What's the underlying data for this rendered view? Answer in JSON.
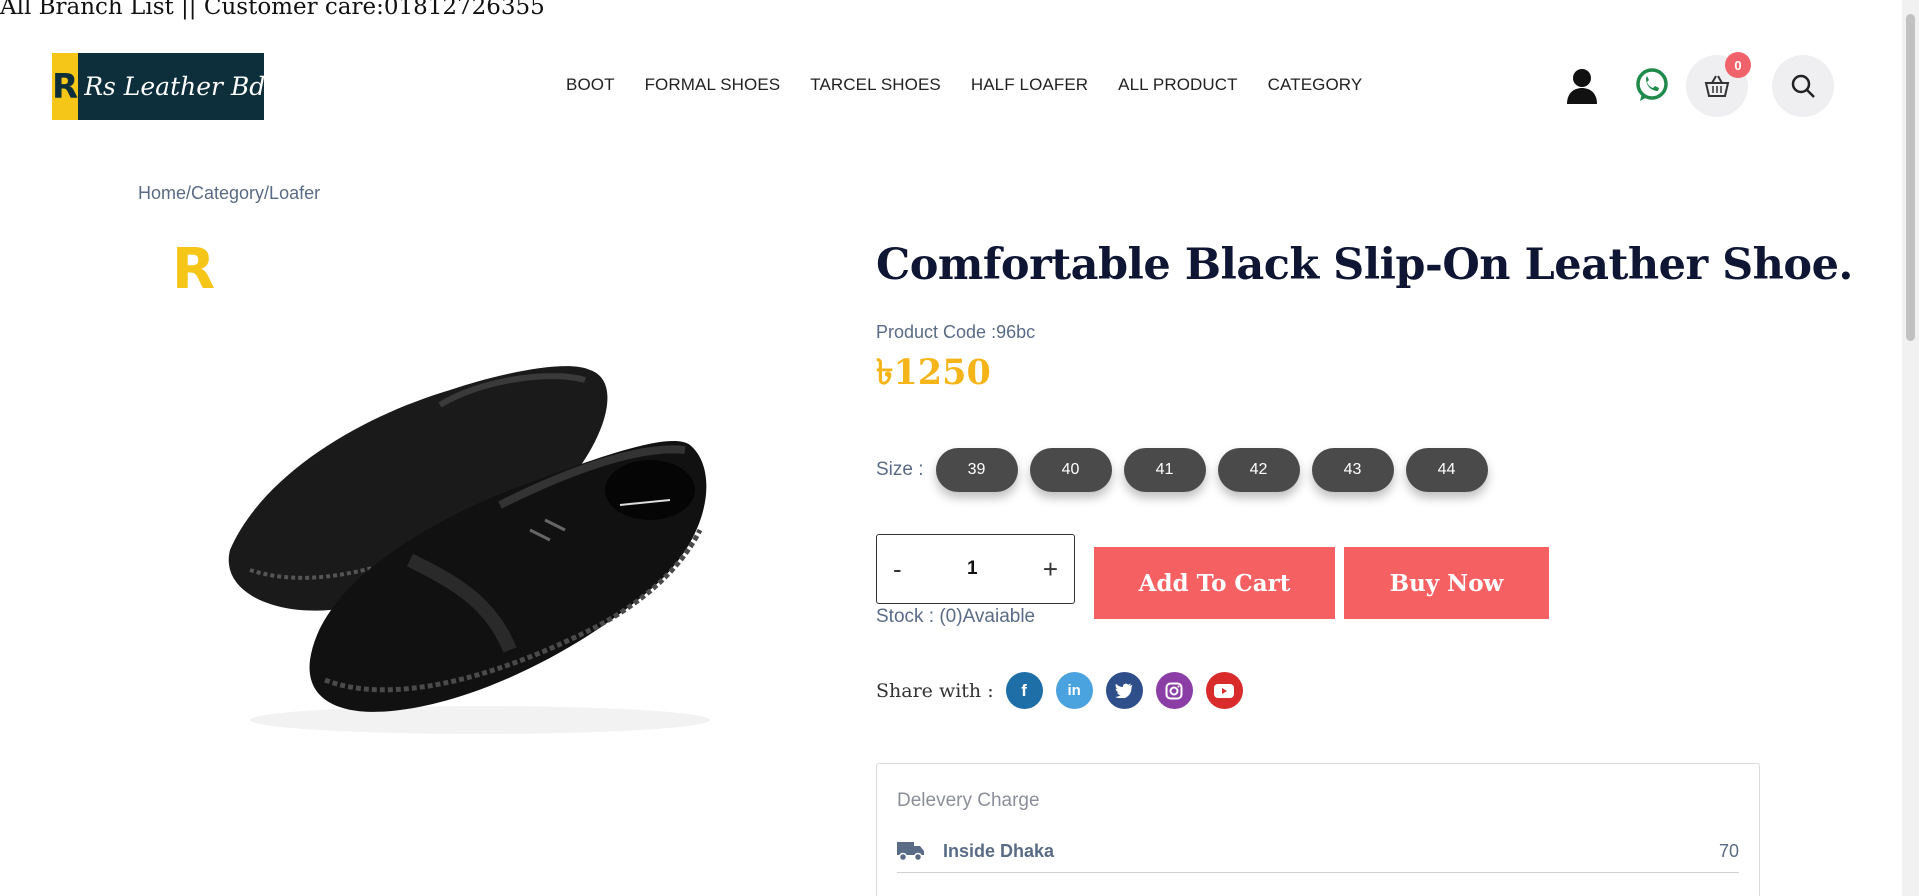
{
  "topbar": {
    "text": "All Branch List || Customer care:01812726355"
  },
  "logo": {
    "mark": "R",
    "text": "Rs Leather Bd"
  },
  "nav": [
    "BOOT",
    "FORMAL SHOES",
    "TARCEL SHOES",
    "HALF LOAFER",
    "ALL PRODUCT",
    "CATEGORY"
  ],
  "header": {
    "cart_count": "0"
  },
  "breadcrumb": "Home/Category/Loafer",
  "image": {
    "brand_mark": "R"
  },
  "product": {
    "title": "Comfortable Black Slip-On Leather Shoe.",
    "code": "Product Code :96bc",
    "price": "৳1250",
    "size_label": "Size :",
    "sizes": [
      "39",
      "40",
      "41",
      "42",
      "43",
      "44"
    ],
    "qty_minus": "-",
    "qty_value": "1",
    "qty_plus": "+",
    "stock": "Stock : (0)Avaiable",
    "add_to_cart": "Add To Cart",
    "buy_now": "Buy Now"
  },
  "share": {
    "label": "Share with :",
    "icons": [
      "facebook-icon",
      "linkedin-icon",
      "twitter-icon",
      "instagram-icon",
      "youtube-icon"
    ]
  },
  "delivery": {
    "title": "Delevery Charge",
    "rows": [
      {
        "name": "Inside Dhaka",
        "value": "70"
      }
    ]
  },
  "colors": {
    "accent": "#f56163",
    "price": "#f5b519",
    "brand_dark": "#0d2f3b",
    "brand_yellow": "#f5c518"
  }
}
